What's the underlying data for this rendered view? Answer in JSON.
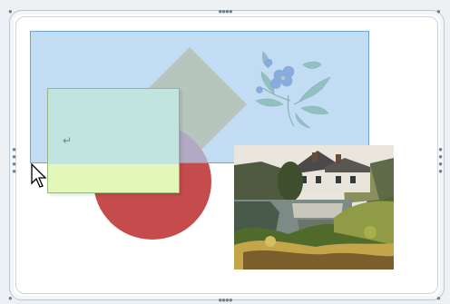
{
  "note": {
    "glyph": "↵"
  },
  "icons": {
    "cursor": "arrow-cursor-icon",
    "paragraph_mark": "paragraph-mark-icon"
  },
  "colors": {
    "selection": "#aacef0",
    "diamond": "#d6b13a",
    "circle": "#c64b4c",
    "note_fill": "#e3f7b8",
    "note_overlay": "#bce0e4"
  }
}
